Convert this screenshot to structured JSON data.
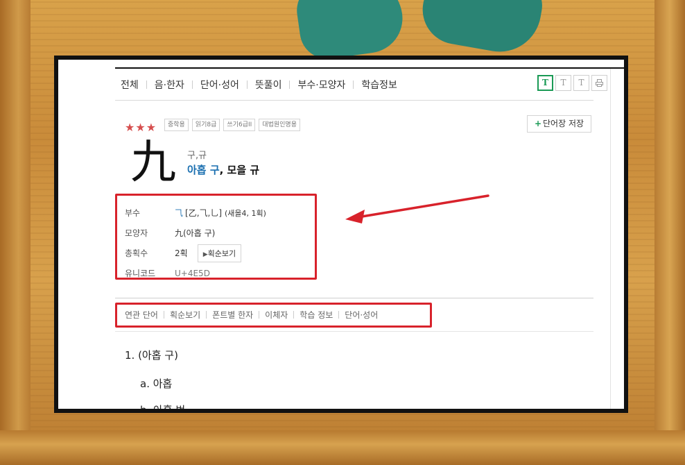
{
  "tabs": [
    "전체",
    "음·한자",
    "단어·성어",
    "뜻풀이",
    "부수·모양자",
    "학습정보"
  ],
  "font_buttons": [
    "T",
    "T",
    "T"
  ],
  "print_icon": "print-icon",
  "rating": "★★★",
  "badges": [
    "중학용",
    "읽기8급",
    "쓰기6급II",
    "대법원인명용"
  ],
  "save_button": "단어장 저장",
  "hanja": {
    "character": "九",
    "reading": "구,규",
    "meaning_prefix": "아홉 구",
    "meaning_rest": ", 모을 규"
  },
  "info": {
    "radical_label": "부수",
    "radical_char": "⺄",
    "radical_variants": "[乙,⺄,乚]",
    "radical_detail": "(새을4, 1획)",
    "shape_label": "모양자",
    "shape_value": "九(아홉 구)",
    "strokes_label": "총획수",
    "strokes_value": "2획",
    "stroke_button": "획순보기",
    "unicode_label": "유니코드",
    "unicode_value": "U+4E5D"
  },
  "subtabs": [
    "연관 단어",
    "획순보기",
    "폰트별 한자",
    "이체자",
    "학습 정보",
    "단어·성어"
  ],
  "definitions": {
    "d1": "1. (아홉 구)",
    "d2": "a.  아홉",
    "d3": "b.  아홉 번"
  },
  "colors": {
    "annotation_red": "#d8222b",
    "accent_green": "#1a9a55",
    "star_red": "#d64e4e"
  }
}
